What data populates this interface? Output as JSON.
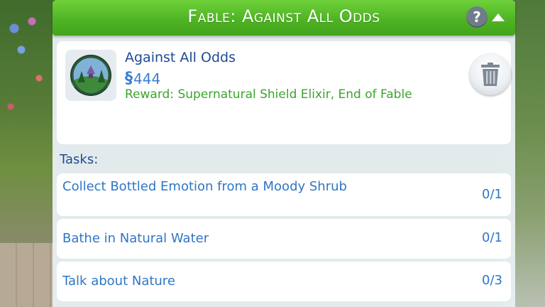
{
  "header": {
    "title": "Fable: Against All Odds",
    "help_label": "?",
    "collapse_icon": "chevron-up-icon"
  },
  "aspiration": {
    "name": "Against All Odds",
    "currency_symbol": "§",
    "reward_points": "444",
    "reward_text": "Reward: Supernatural Shield Elixir, End of Fable",
    "icon": "forest-aspiration-icon",
    "remove_icon": "trash-icon"
  },
  "tasks": {
    "heading": "Tasks:",
    "items": [
      {
        "label": "Collect Bottled Emotion from a Moody Shrub",
        "progress": "0/1"
      },
      {
        "label": "Bathe in Natural Water",
        "progress": "0/1"
      },
      {
        "label": "Talk about Nature",
        "progress": "0/3"
      }
    ]
  },
  "colors": {
    "title_bar": "#4fb424",
    "heading_blue": "#1e4a94",
    "task_blue": "#2f76c6",
    "reward_green": "#3aa52c",
    "panel_bg": "#e8eef2"
  }
}
